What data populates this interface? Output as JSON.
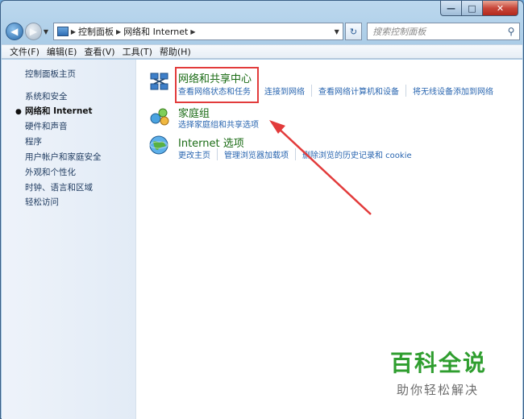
{
  "window": {
    "min_label": "—",
    "max_label": "□",
    "close_label": "✕"
  },
  "address": {
    "segments": [
      "控制面板",
      "网络和 Internet"
    ],
    "search_placeholder": "搜索控制面板"
  },
  "menu": [
    "文件(F)",
    "编辑(E)",
    "查看(V)",
    "工具(T)",
    "帮助(H)"
  ],
  "sidebar": {
    "items": [
      {
        "label": "控制面板主页"
      },
      {
        "label": "系统和安全"
      },
      {
        "label": "网络和 Internet",
        "active": true
      },
      {
        "label": "硬件和声音"
      },
      {
        "label": "程序"
      },
      {
        "label": "用户帐户和家庭安全"
      },
      {
        "label": "外观和个性化"
      },
      {
        "label": "时钟、语言和区域"
      },
      {
        "label": "轻松访问"
      }
    ]
  },
  "categories": [
    {
      "title": "网络和共享中心",
      "icon": "network-center-icon",
      "links": [
        "查看网络状态和任务",
        "连接到网络",
        "查看网络计算机和设备",
        "将无线设备添加到网络"
      ]
    },
    {
      "title": "家庭组",
      "icon": "homegroup-icon",
      "links": [
        "选择家庭组和共享选项"
      ]
    },
    {
      "title": "Internet 选项",
      "icon": "internet-globe-icon",
      "links": [
        "更改主页",
        "管理浏览器加载项",
        "删除浏览的历史记录和 cookie"
      ]
    }
  ],
  "watermark": {
    "title": "百科全说",
    "subtitle": "助你轻松解决"
  },
  "colors": {
    "link": "#2a66b0",
    "category_title": "#1a6b14",
    "annotation_red": "#e23b3b",
    "watermark_green": "#2f9e2f"
  }
}
